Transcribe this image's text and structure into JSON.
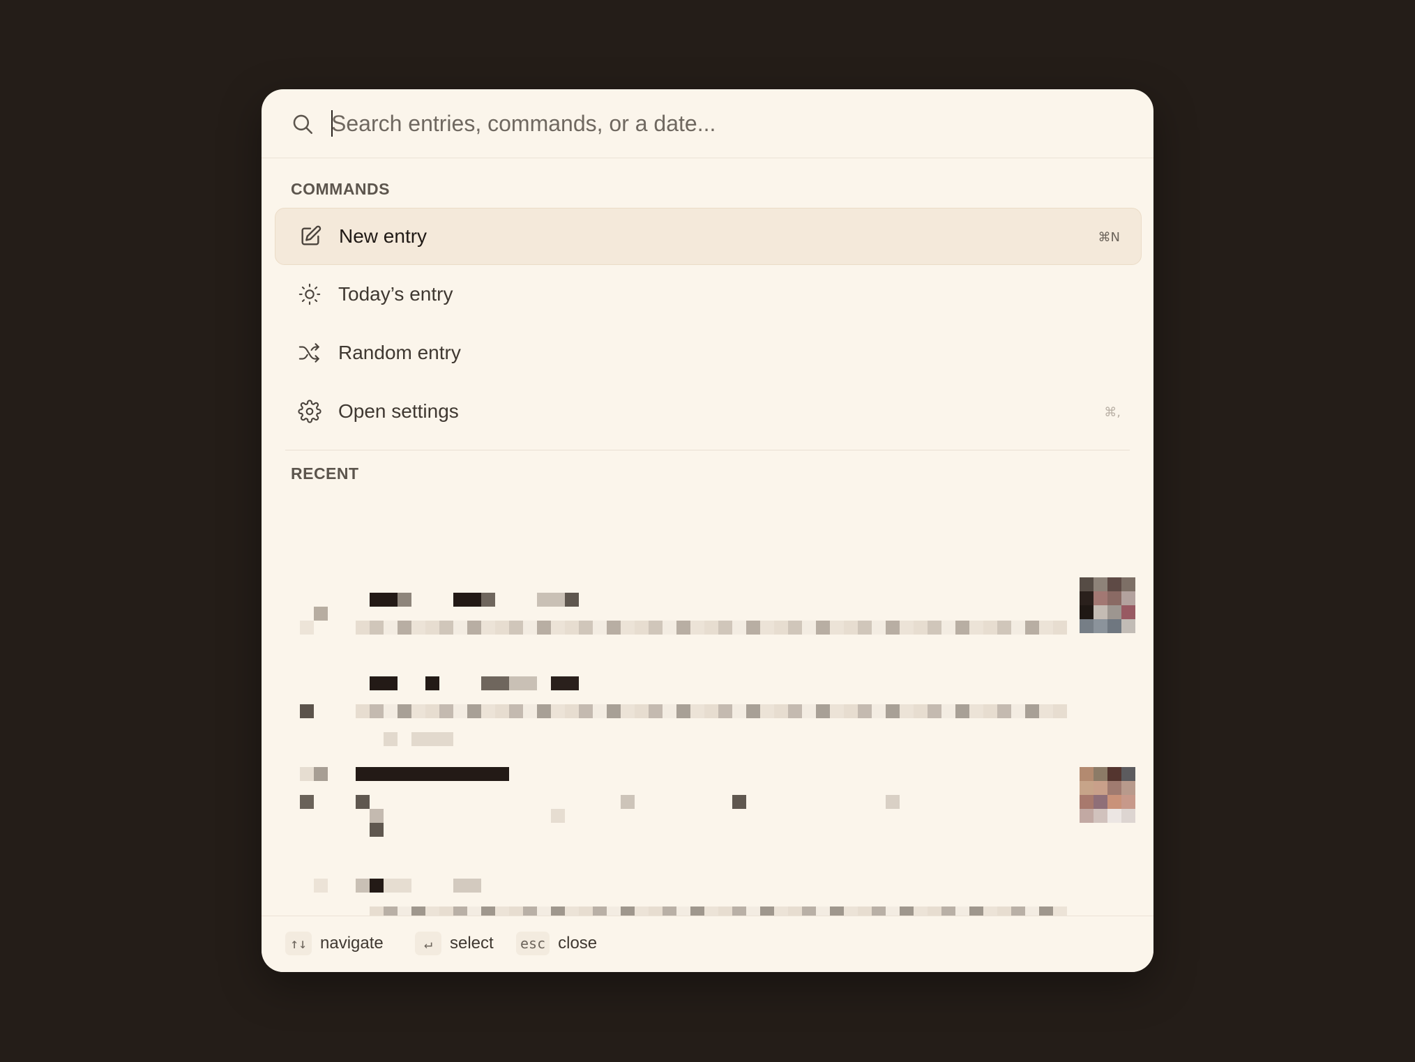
{
  "search": {
    "placeholder": "Search entries, commands, or a date...",
    "value": ""
  },
  "sections": {
    "commands_label": "COMMANDS",
    "recent_label": "RECENT"
  },
  "commands": [
    {
      "label": "New entry",
      "icon": "pencil-square-icon",
      "shortcut": "⌘N",
      "selected": true
    },
    {
      "label": "Today’s entry",
      "icon": "sun-icon",
      "shortcut": "",
      "selected": false
    },
    {
      "label": "Random entry",
      "icon": "shuffle-icon",
      "shortcut": "",
      "selected": false
    },
    {
      "label": "Open settings",
      "icon": "gear-icon",
      "shortcut": "⌘,",
      "selected": false
    }
  ],
  "footer": {
    "navigate_key": "↑↓",
    "navigate_label": "navigate",
    "select_key": "↵",
    "select_label": "select",
    "close_key": "esc",
    "close_label": "close"
  },
  "colors": {
    "background": "#241d18",
    "panel": "#fbf5eb",
    "selected_row": "#f4e9da",
    "text": "#3f3831"
  }
}
